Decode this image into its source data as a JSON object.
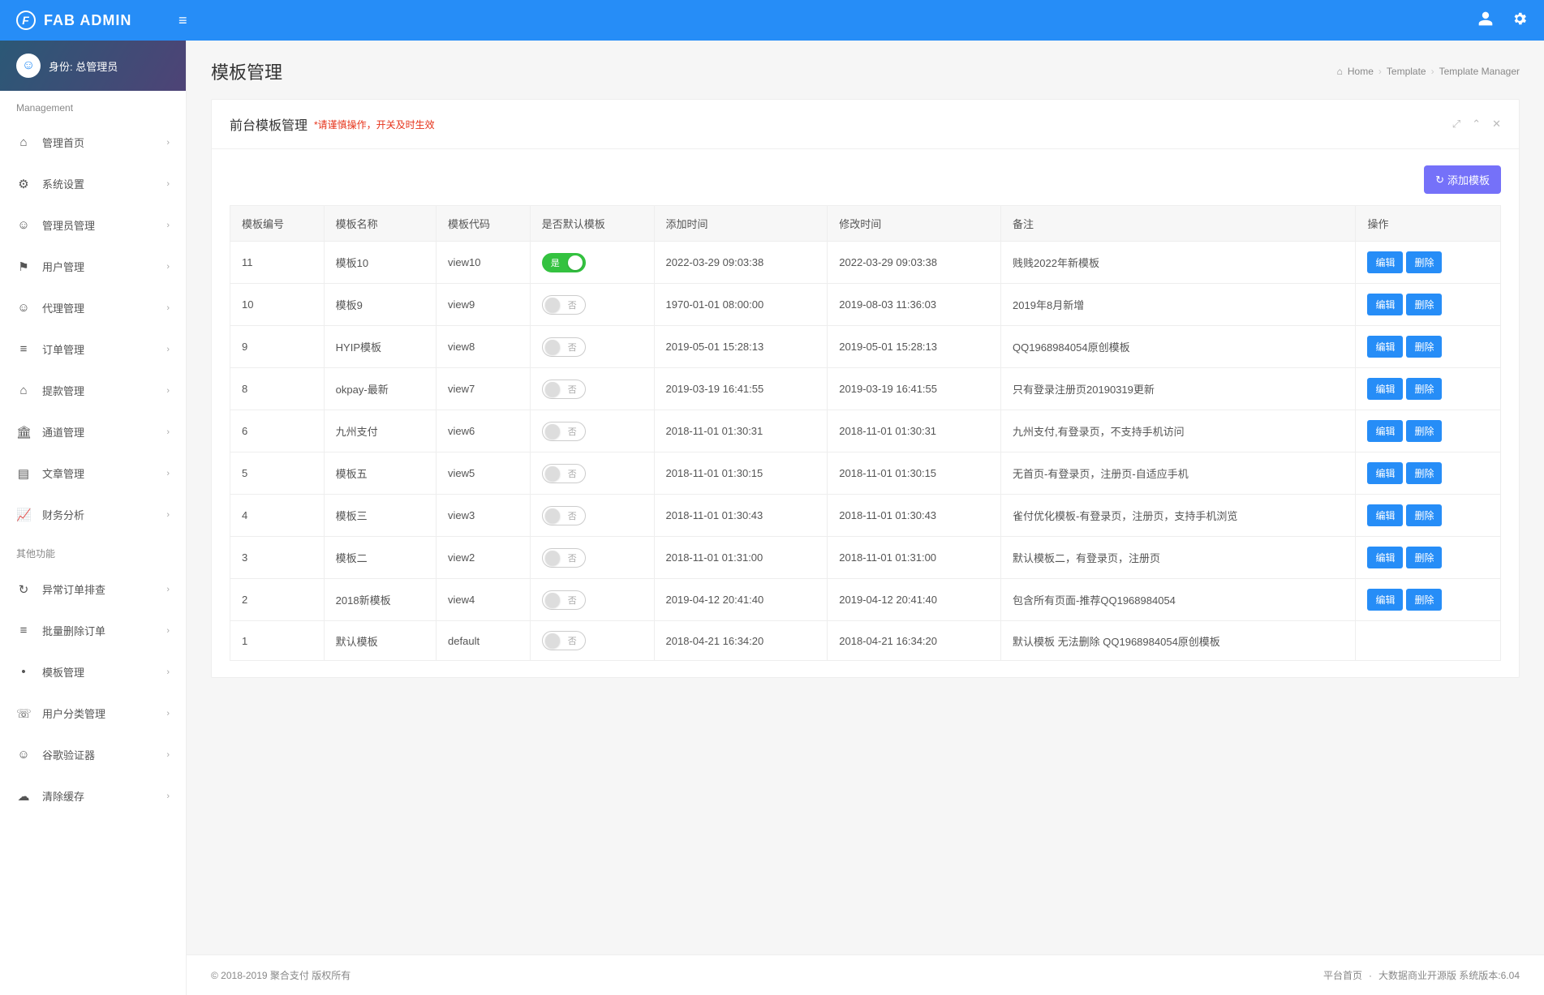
{
  "brand": "FAB ADMIN",
  "user": {
    "role_label": "身份: 总管理员"
  },
  "sidebar": {
    "header1": "Management",
    "header2": "其他功能",
    "group1": [
      {
        "label": "管理首页"
      },
      {
        "label": "系统设置"
      },
      {
        "label": "管理员管理"
      },
      {
        "label": "用户管理"
      },
      {
        "label": "代理管理"
      },
      {
        "label": "订单管理"
      },
      {
        "label": "提款管理"
      },
      {
        "label": "通道管理"
      },
      {
        "label": "文章管理"
      },
      {
        "label": "财务分析"
      }
    ],
    "group2": [
      {
        "label": "异常订单排查"
      },
      {
        "label": "批量删除订单"
      },
      {
        "label": "模板管理"
      },
      {
        "label": "用户分类管理"
      },
      {
        "label": "谷歌验证器"
      },
      {
        "label": "清除缓存"
      }
    ]
  },
  "page": {
    "title": "模板管理",
    "breadcrumb": [
      "Home",
      "Template",
      "Template Manager"
    ]
  },
  "panel": {
    "title": "前台模板管理",
    "warn": "*请谨慎操作，开关及时生效",
    "add_btn": "添加模板"
  },
  "table": {
    "headers": [
      "模板编号",
      "模板名称",
      "模板代码",
      "是否默认模板",
      "添加时间",
      "修改时间",
      "备注",
      "操作"
    ],
    "switch_on_label": "是",
    "switch_off_label": "否",
    "edit_label": "编辑",
    "delete_label": "删除",
    "rows": [
      {
        "id": "11",
        "name": "模板10",
        "code": "view10",
        "default": true,
        "add_time": "2022-03-29 09:03:38",
        "mod_time": "2022-03-29 09:03:38",
        "remark": "贱贱2022年新模板",
        "actions": true
      },
      {
        "id": "10",
        "name": "模板9",
        "code": "view9",
        "default": false,
        "add_time": "1970-01-01 08:00:00",
        "mod_time": "2019-08-03 11:36:03",
        "remark": "2019年8月新增",
        "actions": true
      },
      {
        "id": "9",
        "name": "HYIP模板",
        "code": "view8",
        "default": false,
        "add_time": "2019-05-01 15:28:13",
        "mod_time": "2019-05-01 15:28:13",
        "remark": "QQ1968984054原创模板",
        "actions": true
      },
      {
        "id": "8",
        "name": "okpay-最新",
        "code": "view7",
        "default": false,
        "add_time": "2019-03-19 16:41:55",
        "mod_time": "2019-03-19 16:41:55",
        "remark": "只有登录注册页20190319更新",
        "actions": true
      },
      {
        "id": "6",
        "name": "九州支付",
        "code": "view6",
        "default": false,
        "add_time": "2018-11-01 01:30:31",
        "mod_time": "2018-11-01 01:30:31",
        "remark": "九州支付,有登录页，不支持手机访问",
        "actions": true
      },
      {
        "id": "5",
        "name": "模板五",
        "code": "view5",
        "default": false,
        "add_time": "2018-11-01 01:30:15",
        "mod_time": "2018-11-01 01:30:15",
        "remark": "无首页-有登录页，注册页-自适应手机",
        "actions": true
      },
      {
        "id": "4",
        "name": "模板三",
        "code": "view3",
        "default": false,
        "add_time": "2018-11-01 01:30:43",
        "mod_time": "2018-11-01 01:30:43",
        "remark": "雀付优化模板-有登录页，注册页，支持手机浏览",
        "actions": true
      },
      {
        "id": "3",
        "name": "模板二",
        "code": "view2",
        "default": false,
        "add_time": "2018-11-01 01:31:00",
        "mod_time": "2018-11-01 01:31:00",
        "remark": "默认模板二，有登录页，注册页",
        "actions": true
      },
      {
        "id": "2",
        "name": "2018新模板",
        "code": "view4",
        "default": false,
        "add_time": "2019-04-12 20:41:40",
        "mod_time": "2019-04-12 20:41:40",
        "remark": "包含所有页面-推荐QQ1968984054",
        "actions": true
      },
      {
        "id": "1",
        "name": "默认模板",
        "code": "default",
        "default": false,
        "add_time": "2018-04-21 16:34:20",
        "mod_time": "2018-04-21 16:34:20",
        "remark": "默认模板 无法删除 QQ1968984054原创模板",
        "actions": false
      }
    ]
  },
  "footer": {
    "copyright": "© 2018-2019 聚合支付 版权所有",
    "link": "平台首页",
    "version": "大数据商业开源版 系统版本:6.04"
  }
}
